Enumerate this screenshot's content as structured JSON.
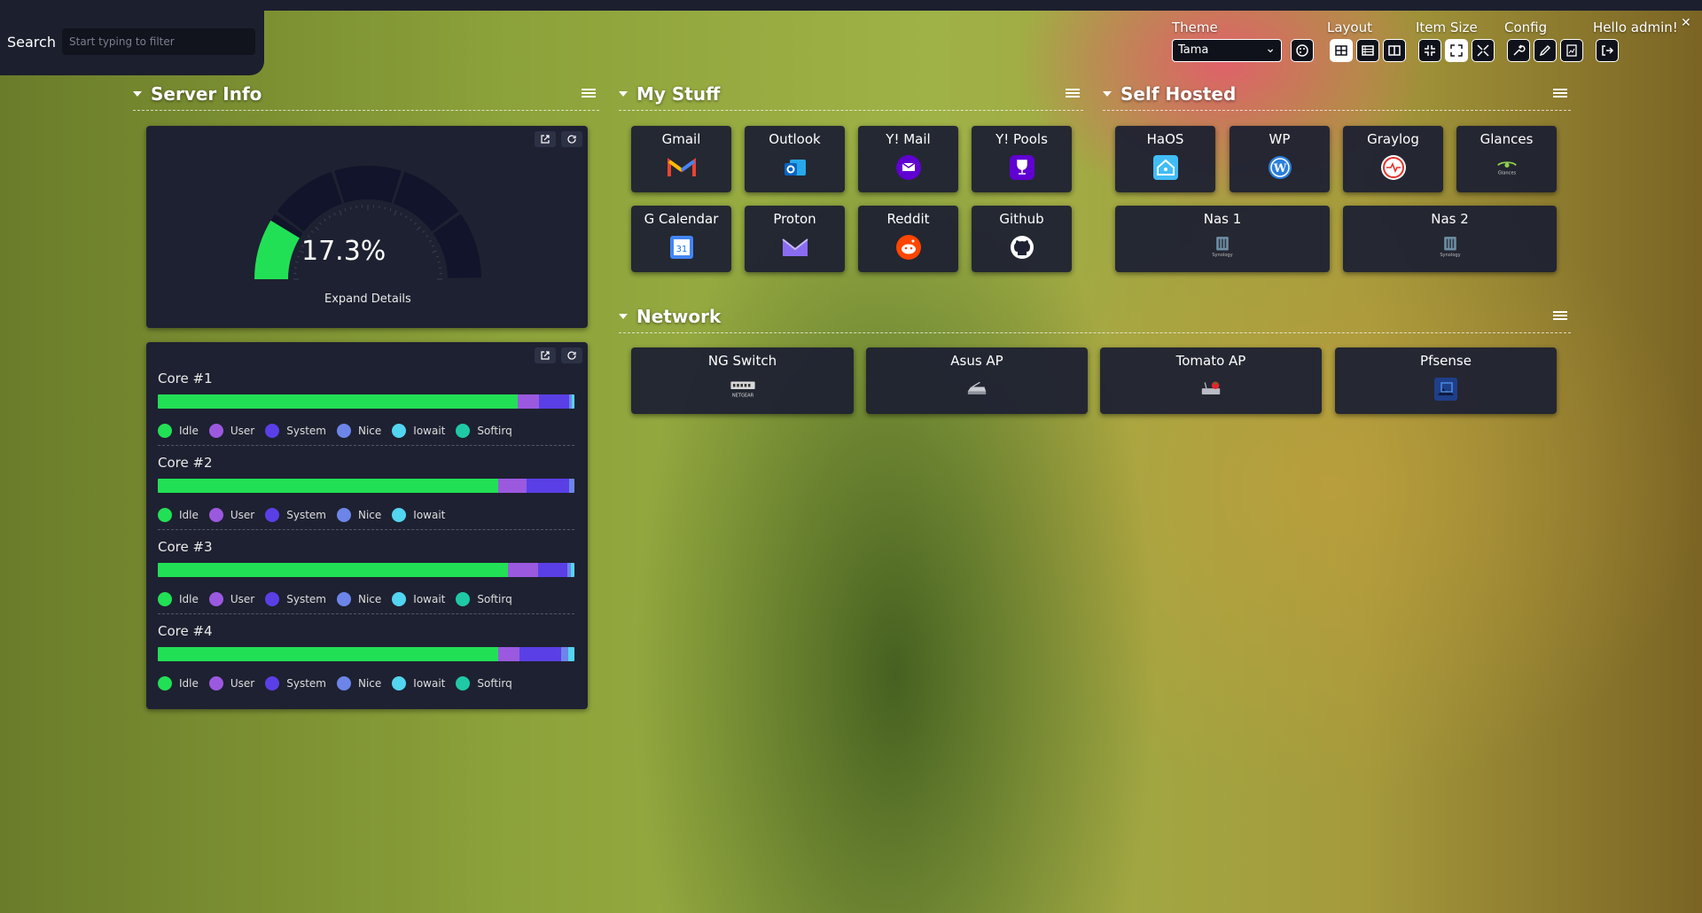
{
  "search": {
    "label": "Search",
    "placeholder": "Start typing to filter"
  },
  "toolbar": {
    "theme_label": "Theme",
    "theme_value": "Tama",
    "layout_label": "Layout",
    "item_size_label": "Item Size",
    "config_label": "Config",
    "greeting": "Hello admin!"
  },
  "sections": {
    "server_info": {
      "title": "Server Info"
    },
    "my_stuff": {
      "title": "My Stuff"
    },
    "self_hosted": {
      "title": "Self Hosted"
    },
    "network": {
      "title": "Network"
    }
  },
  "gauge": {
    "value": "17.3%",
    "percent": 17.3,
    "details": "Expand Details",
    "color": "#22e055"
  },
  "cpu": {
    "cores": [
      {
        "title": "Core #1",
        "legend": [
          "Idle",
          "User",
          "System",
          "Nice",
          "Iowait",
          "Softirq"
        ]
      },
      {
        "title": "Core #2",
        "legend": [
          "Idle",
          "User",
          "System",
          "Nice",
          "Iowait"
        ]
      },
      {
        "title": "Core #3",
        "legend": [
          "Idle",
          "User",
          "System",
          "Nice",
          "Iowait",
          "Softirq"
        ]
      },
      {
        "title": "Core #4",
        "legend": [
          "Idle",
          "User",
          "System",
          "Nice",
          "Iowait",
          "Softirq"
        ]
      }
    ],
    "colors": {
      "Idle": "#22e055",
      "User": "#9b59e0",
      "System": "#5a3fe6",
      "Nice": "#6d85e8",
      "Iowait": "#52d5f0",
      "Softirq": "#1fc9a6"
    }
  },
  "my_stuff": [
    {
      "label": "Gmail",
      "icon": "gmail-icon"
    },
    {
      "label": "Outlook",
      "icon": "outlook-icon"
    },
    {
      "label": "Y! Mail",
      "icon": "yahoo-mail-icon"
    },
    {
      "label": "Y! Pools",
      "icon": "yahoo-pools-icon"
    },
    {
      "label": "G Calendar",
      "icon": "google-calendar-icon"
    },
    {
      "label": "Proton",
      "icon": "proton-icon"
    },
    {
      "label": "Reddit",
      "icon": "reddit-icon"
    },
    {
      "label": "Github",
      "icon": "github-icon"
    }
  ],
  "self_hosted": [
    {
      "label": "HaOS",
      "icon": "home-assistant-icon"
    },
    {
      "label": "WP",
      "icon": "wordpress-icon"
    },
    {
      "label": "Graylog",
      "icon": "graylog-icon"
    },
    {
      "label": "Glances",
      "icon": "glances-icon",
      "sub": "Glances"
    },
    {
      "label": "Nas 1",
      "icon": "synology-icon",
      "sub": "Synology"
    },
    {
      "label": "Nas 2",
      "icon": "synology-icon",
      "sub": "Synology"
    }
  ],
  "network": [
    {
      "label": "NG Switch",
      "icon": "netgear-icon",
      "sub": "NETGEAR"
    },
    {
      "label": "Asus AP",
      "icon": "router-icon"
    },
    {
      "label": "Tomato AP",
      "icon": "tomato-router-icon"
    },
    {
      "label": "Pfsense",
      "icon": "pfsense-icon"
    }
  ]
}
